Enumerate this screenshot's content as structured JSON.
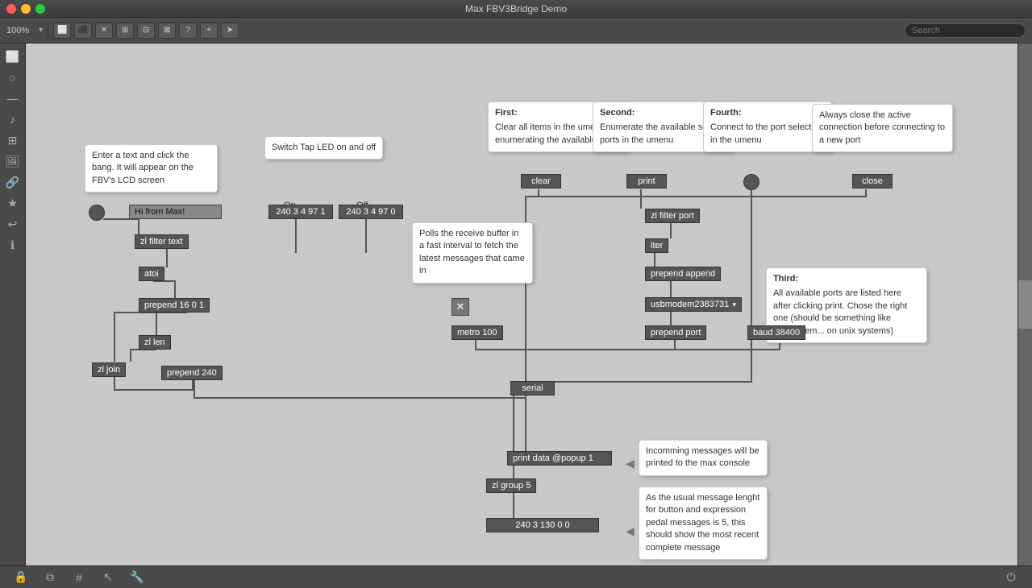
{
  "titlebar": {
    "title": "Max FBV3Bridge Demo"
  },
  "toolbar": {
    "zoom": "100%",
    "search_placeholder": "Search"
  },
  "nodes": {
    "comment1": {
      "text": "Enter a text and click the bang. It will appear on the FBV's LCD screen"
    },
    "comment2": {
      "text": "Switch Tap LED on and off"
    },
    "comment_first": {
      "label": "First:",
      "text": "Clear all items in the umenu enumerating the available ports"
    },
    "comment_second": {
      "label": "Second:",
      "text": "Enumerate the available serial ports in the umenu"
    },
    "comment_fourth": {
      "label": "Fourth:",
      "text": "Connect to the port selected in the umenu"
    },
    "comment_always": {
      "text": "Always close the active connection before connecting to a new port"
    },
    "comment_polls": {
      "text": "Polls the receive buffer in a fast interval to fetch the latest messages that came in"
    },
    "comment_third": {
      "label": "Third:",
      "text": "All available ports are listed here after clicking print. Chose the right one (should be something like usbmodem... on unix systems)"
    },
    "comment_incomming": {
      "text": "Incomming messages will be printed to the max console"
    },
    "comment_usual": {
      "text": "As the usual message lenght for button and expression pedal messages is 5, this should show the most recent complete message"
    },
    "btn_clear": "clear",
    "btn_print": "print",
    "btn_close": "close",
    "btn_on": "On",
    "btn_off": "Off",
    "node_240_on": "240 3 4 97 1",
    "node_240_off": "240 3 4 97 0",
    "node_hi": "Hi from Max!",
    "node_zl_filter_text": "zl filter text",
    "node_atoi": "atoi",
    "node_prepend_16": "prepend 16 0 1",
    "node_zl_len": "zl len",
    "node_zl_join": "zl join",
    "node_prepend_240": "prepend 240",
    "node_zl_filter_port": "zl filter port",
    "node_iter": "iter",
    "node_prepend_append": "prepend append",
    "node_usbmodem": "usbmodem2383731",
    "node_prepend_port": "prepend port",
    "node_baud": "baud 38400",
    "node_serial": "serial",
    "node_metro": "metro 100",
    "node_print_data": "print data @popup 1",
    "node_zl_group5": "zl group 5",
    "node_240_3_130": "240 3 130 0 0"
  },
  "bottombar": {
    "icons": [
      "lock",
      "layers",
      "grid",
      "cursor",
      "wrench"
    ]
  }
}
